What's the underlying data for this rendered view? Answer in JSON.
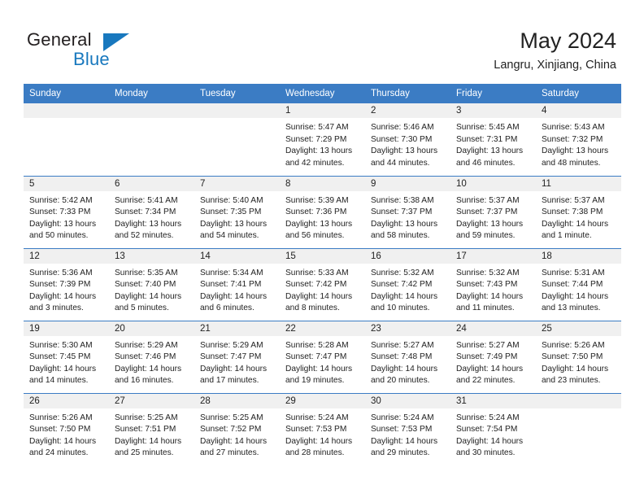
{
  "logo": {
    "line1": "General",
    "line2": "Blue",
    "triangle_icon": "blue-triangle-icon"
  },
  "header": {
    "title": "May 2024",
    "subtitle": "Langru, Xinjiang, China"
  },
  "colors": {
    "header_blue": "#3b7cc4",
    "logo_blue": "#1878be",
    "daynum_band": "#f0f0f0",
    "text": "#222222",
    "page_background": "#ffffff"
  },
  "calendar": {
    "weekday_headers": [
      "Sunday",
      "Monday",
      "Tuesday",
      "Wednesday",
      "Thursday",
      "Friday",
      "Saturday"
    ],
    "weeks": [
      [
        {
          "day": "",
          "empty": true,
          "sunrise": "",
          "sunset": "",
          "daylight_1": "",
          "daylight_2": ""
        },
        {
          "day": "",
          "empty": true,
          "sunrise": "",
          "sunset": "",
          "daylight_1": "",
          "daylight_2": ""
        },
        {
          "day": "",
          "empty": true,
          "sunrise": "",
          "sunset": "",
          "daylight_1": "",
          "daylight_2": ""
        },
        {
          "day": "1",
          "empty": false,
          "sunrise": "Sunrise: 5:47 AM",
          "sunset": "Sunset: 7:29 PM",
          "daylight_1": "Daylight: 13 hours",
          "daylight_2": "and 42 minutes."
        },
        {
          "day": "2",
          "empty": false,
          "sunrise": "Sunrise: 5:46 AM",
          "sunset": "Sunset: 7:30 PM",
          "daylight_1": "Daylight: 13 hours",
          "daylight_2": "and 44 minutes."
        },
        {
          "day": "3",
          "empty": false,
          "sunrise": "Sunrise: 5:45 AM",
          "sunset": "Sunset: 7:31 PM",
          "daylight_1": "Daylight: 13 hours",
          "daylight_2": "and 46 minutes."
        },
        {
          "day": "4",
          "empty": false,
          "sunrise": "Sunrise: 5:43 AM",
          "sunset": "Sunset: 7:32 PM",
          "daylight_1": "Daylight: 13 hours",
          "daylight_2": "and 48 minutes."
        }
      ],
      [
        {
          "day": "5",
          "empty": false,
          "sunrise": "Sunrise: 5:42 AM",
          "sunset": "Sunset: 7:33 PM",
          "daylight_1": "Daylight: 13 hours",
          "daylight_2": "and 50 minutes."
        },
        {
          "day": "6",
          "empty": false,
          "sunrise": "Sunrise: 5:41 AM",
          "sunset": "Sunset: 7:34 PM",
          "daylight_1": "Daylight: 13 hours",
          "daylight_2": "and 52 minutes."
        },
        {
          "day": "7",
          "empty": false,
          "sunrise": "Sunrise: 5:40 AM",
          "sunset": "Sunset: 7:35 PM",
          "daylight_1": "Daylight: 13 hours",
          "daylight_2": "and 54 minutes."
        },
        {
          "day": "8",
          "empty": false,
          "sunrise": "Sunrise: 5:39 AM",
          "sunset": "Sunset: 7:36 PM",
          "daylight_1": "Daylight: 13 hours",
          "daylight_2": "and 56 minutes."
        },
        {
          "day": "9",
          "empty": false,
          "sunrise": "Sunrise: 5:38 AM",
          "sunset": "Sunset: 7:37 PM",
          "daylight_1": "Daylight: 13 hours",
          "daylight_2": "and 58 minutes."
        },
        {
          "day": "10",
          "empty": false,
          "sunrise": "Sunrise: 5:37 AM",
          "sunset": "Sunset: 7:37 PM",
          "daylight_1": "Daylight: 13 hours",
          "daylight_2": "and 59 minutes."
        },
        {
          "day": "11",
          "empty": false,
          "sunrise": "Sunrise: 5:37 AM",
          "sunset": "Sunset: 7:38 PM",
          "daylight_1": "Daylight: 14 hours",
          "daylight_2": "and 1 minute."
        }
      ],
      [
        {
          "day": "12",
          "empty": false,
          "sunrise": "Sunrise: 5:36 AM",
          "sunset": "Sunset: 7:39 PM",
          "daylight_1": "Daylight: 14 hours",
          "daylight_2": "and 3 minutes."
        },
        {
          "day": "13",
          "empty": false,
          "sunrise": "Sunrise: 5:35 AM",
          "sunset": "Sunset: 7:40 PM",
          "daylight_1": "Daylight: 14 hours",
          "daylight_2": "and 5 minutes."
        },
        {
          "day": "14",
          "empty": false,
          "sunrise": "Sunrise: 5:34 AM",
          "sunset": "Sunset: 7:41 PM",
          "daylight_1": "Daylight: 14 hours",
          "daylight_2": "and 6 minutes."
        },
        {
          "day": "15",
          "empty": false,
          "sunrise": "Sunrise: 5:33 AM",
          "sunset": "Sunset: 7:42 PM",
          "daylight_1": "Daylight: 14 hours",
          "daylight_2": "and 8 minutes."
        },
        {
          "day": "16",
          "empty": false,
          "sunrise": "Sunrise: 5:32 AM",
          "sunset": "Sunset: 7:42 PM",
          "daylight_1": "Daylight: 14 hours",
          "daylight_2": "and 10 minutes."
        },
        {
          "day": "17",
          "empty": false,
          "sunrise": "Sunrise: 5:32 AM",
          "sunset": "Sunset: 7:43 PM",
          "daylight_1": "Daylight: 14 hours",
          "daylight_2": "and 11 minutes."
        },
        {
          "day": "18",
          "empty": false,
          "sunrise": "Sunrise: 5:31 AM",
          "sunset": "Sunset: 7:44 PM",
          "daylight_1": "Daylight: 14 hours",
          "daylight_2": "and 13 minutes."
        }
      ],
      [
        {
          "day": "19",
          "empty": false,
          "sunrise": "Sunrise: 5:30 AM",
          "sunset": "Sunset: 7:45 PM",
          "daylight_1": "Daylight: 14 hours",
          "daylight_2": "and 14 minutes."
        },
        {
          "day": "20",
          "empty": false,
          "sunrise": "Sunrise: 5:29 AM",
          "sunset": "Sunset: 7:46 PM",
          "daylight_1": "Daylight: 14 hours",
          "daylight_2": "and 16 minutes."
        },
        {
          "day": "21",
          "empty": false,
          "sunrise": "Sunrise: 5:29 AM",
          "sunset": "Sunset: 7:47 PM",
          "daylight_1": "Daylight: 14 hours",
          "daylight_2": "and 17 minutes."
        },
        {
          "day": "22",
          "empty": false,
          "sunrise": "Sunrise: 5:28 AM",
          "sunset": "Sunset: 7:47 PM",
          "daylight_1": "Daylight: 14 hours",
          "daylight_2": "and 19 minutes."
        },
        {
          "day": "23",
          "empty": false,
          "sunrise": "Sunrise: 5:27 AM",
          "sunset": "Sunset: 7:48 PM",
          "daylight_1": "Daylight: 14 hours",
          "daylight_2": "and 20 minutes."
        },
        {
          "day": "24",
          "empty": false,
          "sunrise": "Sunrise: 5:27 AM",
          "sunset": "Sunset: 7:49 PM",
          "daylight_1": "Daylight: 14 hours",
          "daylight_2": "and 22 minutes."
        },
        {
          "day": "25",
          "empty": false,
          "sunrise": "Sunrise: 5:26 AM",
          "sunset": "Sunset: 7:50 PM",
          "daylight_1": "Daylight: 14 hours",
          "daylight_2": "and 23 minutes."
        }
      ],
      [
        {
          "day": "26",
          "empty": false,
          "sunrise": "Sunrise: 5:26 AM",
          "sunset": "Sunset: 7:50 PM",
          "daylight_1": "Daylight: 14 hours",
          "daylight_2": "and 24 minutes."
        },
        {
          "day": "27",
          "empty": false,
          "sunrise": "Sunrise: 5:25 AM",
          "sunset": "Sunset: 7:51 PM",
          "daylight_1": "Daylight: 14 hours",
          "daylight_2": "and 25 minutes."
        },
        {
          "day": "28",
          "empty": false,
          "sunrise": "Sunrise: 5:25 AM",
          "sunset": "Sunset: 7:52 PM",
          "daylight_1": "Daylight: 14 hours",
          "daylight_2": "and 27 minutes."
        },
        {
          "day": "29",
          "empty": false,
          "sunrise": "Sunrise: 5:24 AM",
          "sunset": "Sunset: 7:53 PM",
          "daylight_1": "Daylight: 14 hours",
          "daylight_2": "and 28 minutes."
        },
        {
          "day": "30",
          "empty": false,
          "sunrise": "Sunrise: 5:24 AM",
          "sunset": "Sunset: 7:53 PM",
          "daylight_1": "Daylight: 14 hours",
          "daylight_2": "and 29 minutes."
        },
        {
          "day": "31",
          "empty": false,
          "sunrise": "Sunrise: 5:24 AM",
          "sunset": "Sunset: 7:54 PM",
          "daylight_1": "Daylight: 14 hours",
          "daylight_2": "and 30 minutes."
        },
        {
          "day": "",
          "empty": true,
          "sunrise": "",
          "sunset": "",
          "daylight_1": "",
          "daylight_2": ""
        }
      ]
    ]
  }
}
